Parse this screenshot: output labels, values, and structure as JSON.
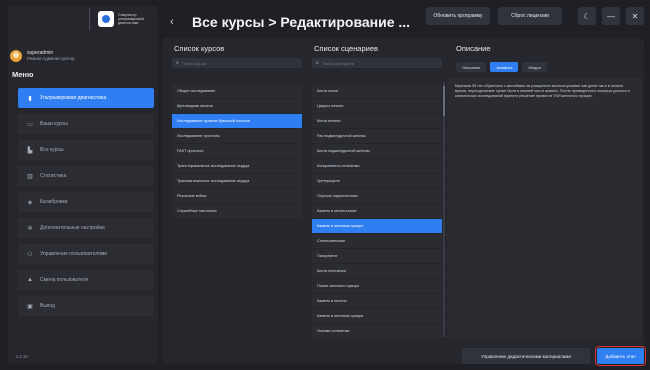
{
  "logo": {
    "text": "Симулятор ультразвуковой диагностики"
  },
  "user": {
    "name": "superadmin",
    "role": "Режим Администратор"
  },
  "menu_title": "Меню",
  "menu": [
    {
      "label": "Ультразвуковая диагностика",
      "icon": "ultrasound-icon",
      "glyph": "▮"
    },
    {
      "label": "Ваши курсы",
      "icon": "courses-icon",
      "glyph": "▭"
    },
    {
      "label": "Все курсы",
      "icon": "all-courses-icon",
      "glyph": "▙"
    },
    {
      "label": "Статистика",
      "icon": "stats-icon",
      "glyph": "▥"
    },
    {
      "label": "Калибровка",
      "icon": "calibration-icon",
      "glyph": "◈"
    },
    {
      "label": "Дополнительные настройки",
      "icon": "settings-icon",
      "glyph": "✲"
    },
    {
      "label": "Управление пользователями",
      "icon": "users-icon",
      "glyph": "⚇"
    },
    {
      "label": "Смена пользователя",
      "icon": "switch-user-icon",
      "glyph": "▲"
    },
    {
      "label": "Выход",
      "icon": "exit-icon",
      "glyph": "▣"
    }
  ],
  "version": "v.3.10",
  "header": {
    "back_glyph": "‹",
    "title": "Все курсы > Редактирование ...",
    "update_btn": "Обновить программу",
    "license_btn": "Сброс лицензии",
    "theme_glyph": "☾",
    "min_glyph": "—",
    "close_glyph": "✕"
  },
  "courses": {
    "title": "Список курсов",
    "search_placeholder": "Поиск курсов",
    "items": [
      "Общее исследование",
      "Щитовидная железа",
      "Исследование органов брюшной полости",
      "Исследование простаты",
      "FAST протокол",
      "Трансторакальное исследование сердца",
      "Трансвагинальное исследование сердца",
      "Реальные кейсы",
      "Служебные патологии"
    ],
    "selected": 2
  },
  "scenarios": {
    "title": "Список сценариев",
    "search_placeholder": "Поиск сценариев",
    "items": [
      "Киста почки",
      "Цирроз печени",
      "Киста печени",
      "Рак поджелудочной железы",
      "Киста поджелудочной железы",
      "Конкременты селезенки",
      "Уретероцеле",
      "Опухоль надпочечника",
      "Камень в мочеточнике",
      "Камень в желчном пузыре",
      "Спленомегалия",
      "Панкреатит",
      "Киста селезенки",
      "Полип желчного пузыря",
      "Камень в печени",
      "Камень в желчном пузыре",
      "Липома селезенки"
    ],
    "selected": 9
  },
  "description": {
    "title": "Описание",
    "tabs": [
      "Описание",
      "Анамнез",
      "Медиа"
    ],
    "active_tab": 1,
    "text": "Мужчина 35 лет обратился с жалобами на учащенное мочеиспускание как днем так и в ночное время, периодические тупые боли в нижней части живота. После проведенного осмотра уролога и клинических исследований принято решение провести УЗИ желчного пузыря."
  },
  "footer": {
    "manage_btn": "Управление дидактическими материалами",
    "add_btn": "Добавить этап"
  }
}
